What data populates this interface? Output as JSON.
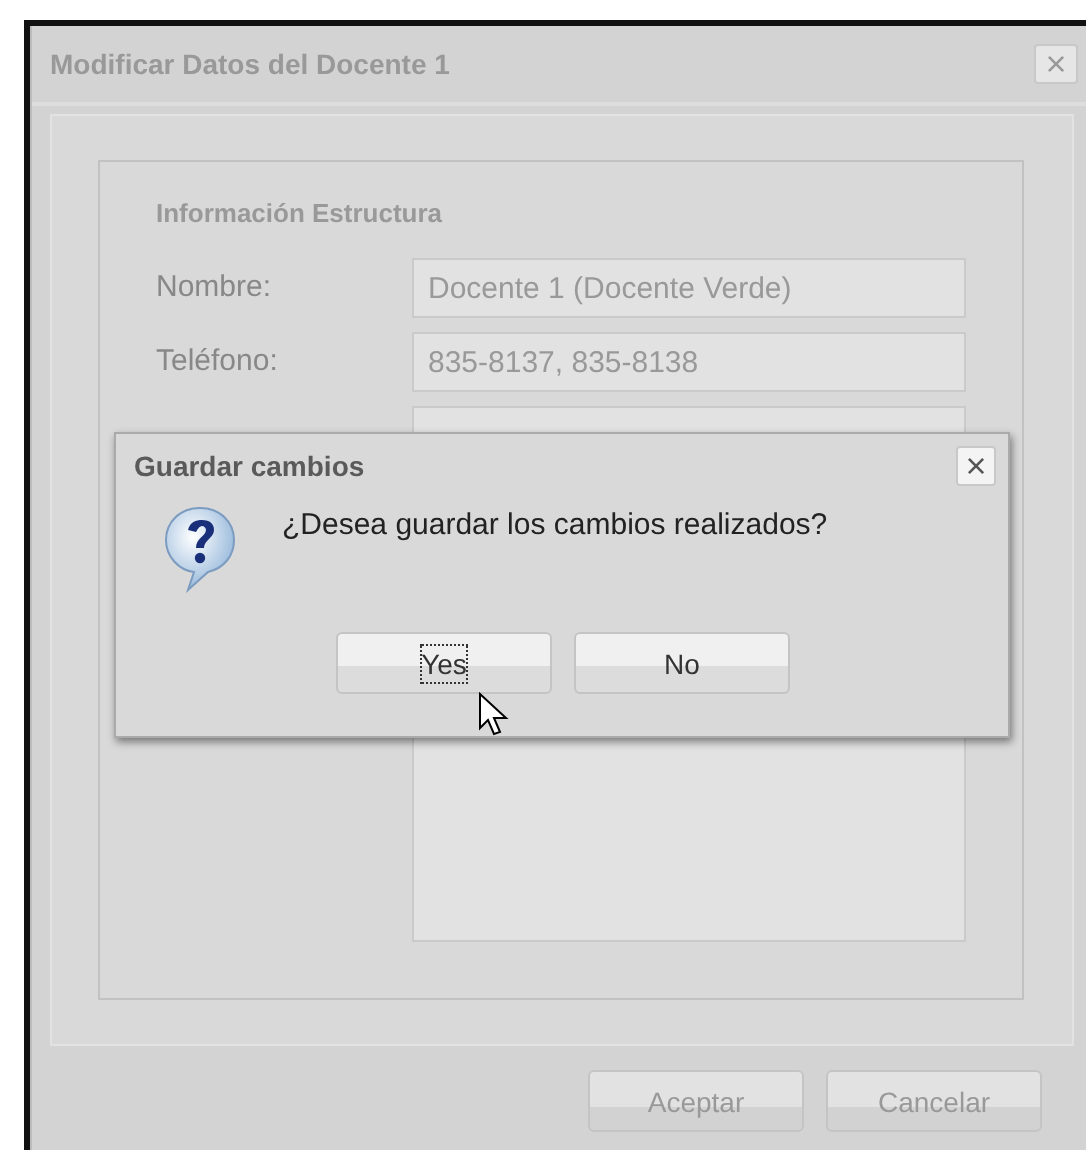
{
  "window": {
    "title": "Modificar Datos del Docente 1",
    "close": "×"
  },
  "section": {
    "title": "Información Estructura"
  },
  "fields": [
    {
      "kind": "text",
      "label": "Nombre:",
      "value": "Docente 1 (Docente Verde)"
    },
    {
      "kind": "text",
      "label": "Teléfono:",
      "value": "835-8137, 835-8138"
    },
    {
      "kind": "area"
    }
  ],
  "buttons": [
    {
      "label": "Aceptar"
    },
    {
      "label": "Cancelar"
    }
  ],
  "modal": {
    "title": "Guardar cambios",
    "close": "×",
    "message": "¿Desea guardar los cambios realizados?",
    "buttons": [
      {
        "label": "Yes",
        "focused": true
      },
      {
        "label": "No",
        "focused": false
      }
    ]
  }
}
